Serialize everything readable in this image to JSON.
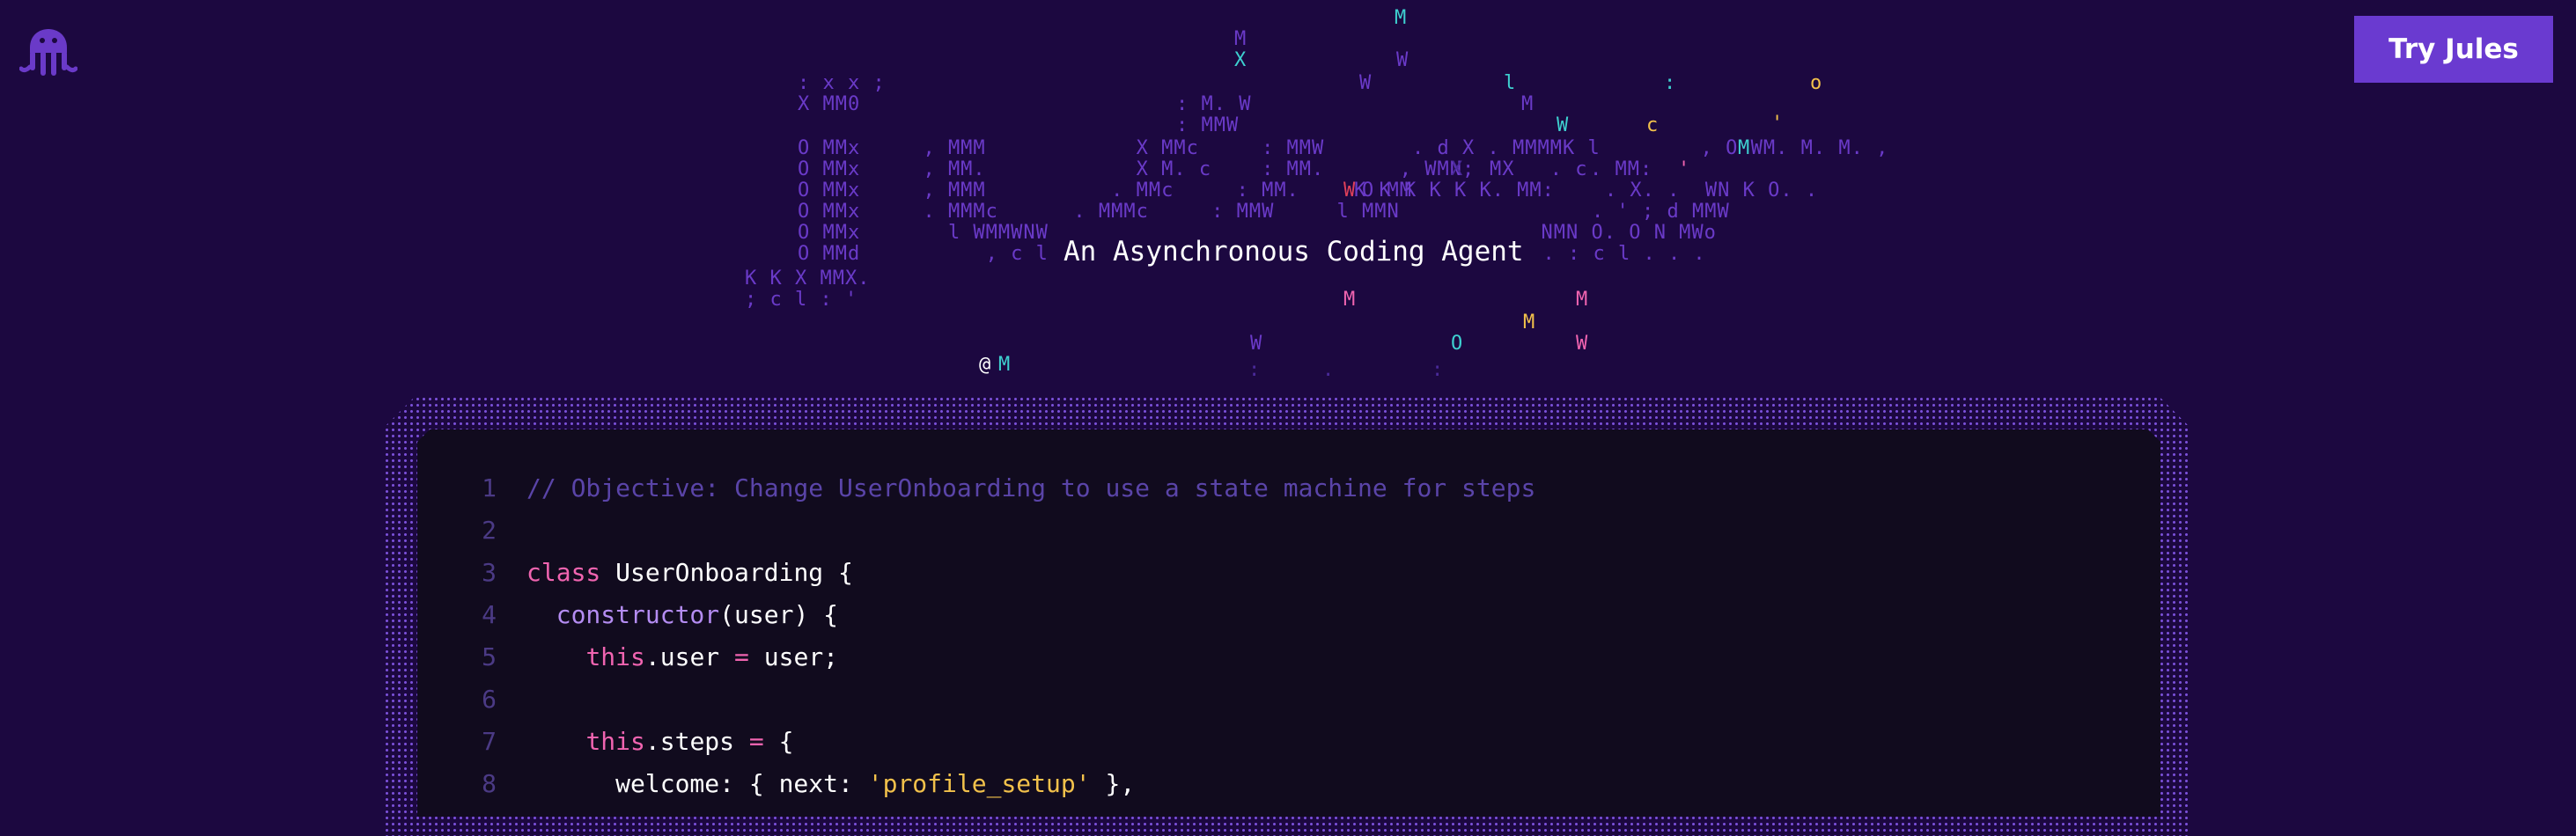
{
  "header": {
    "logo_icon": "octopus-logo-icon",
    "try_button_label": "Try Jules"
  },
  "hero": {
    "tagline": "An Asynchronous Coding Agent",
    "ascii_art": [
      {
        "text": "M",
        "color": "#3ed0d0",
        "left": 0,
        "top": 0
      },
      {
        "text": "M",
        "color": "#6a3ac8"
      },
      {
        "text": "X",
        "color": "#3ed0d0"
      },
      {
        "text": "W",
        "color": "#6a3ac8"
      },
      {
        "text": ": x x ;",
        "color": "#6a3ac8"
      },
      {
        "text": "W",
        "color": "#6a3ac8"
      },
      {
        "text": "l",
        "color": "#3ed0d0"
      },
      {
        "text": ":",
        "color": "#3ed0d0"
      },
      {
        "text": "o",
        "color": "#f2c14b"
      },
      {
        "text": "X MM0",
        "color": "#6a3ac8"
      },
      {
        "text": ": M. W",
        "color": "#6a3ac8"
      },
      {
        "text": "M",
        "color": "#6a3ac8"
      },
      {
        "text": ": MMW",
        "color": "#6a3ac8"
      },
      {
        "text": "W",
        "color": "#3ed0d0"
      },
      {
        "text": "c",
        "color": "#f2c14b"
      },
      {
        "text": "'",
        "color": "#f2c14b"
      },
      {
        "text": "O MMx     , MMM            X MMc     : MMW       . d X . MMMMK l        , O WM. M. M. ,",
        "color": "#6a3ac8"
      },
      {
        "text": "M",
        "color": "#3ed0d0"
      },
      {
        "text": "O MMx     , MM.            X M. c    : MM.      , WMN;      . c",
        "color": "#6a3ac8"
      },
      {
        "text": "X",
        "color": "#4a2a9a"
      },
      {
        "text": "MX      . MM:",
        "color": "#6a3ac8"
      },
      {
        "text": "'",
        "color": "#f064b0"
      },
      {
        "text": "O MMx     , MMM          . MMc     : MM.     O MM",
        "color": "#6a3ac8"
      },
      {
        "text": "W",
        "color": "#e0405a"
      },
      {
        "text": "K K K K K K. MM:    . X. .  WN K O. .",
        "color": "#6a3ac8"
      },
      {
        "text": "O MMx     . MMMc      . MMMc     : MMW     l MMN",
        "color": "#6a3ac8"
      },
      {
        "text": ". ' ; d MMW",
        "color": "#6a3ac8"
      },
      {
        "text": "O MMx       l WMMWNW",
        "color": "#6a3ac8"
      },
      {
        "text": ". NMN O. O N MWo",
        "color": "#6a3ac8"
      },
      {
        "text": "O MMd          , c l c ,",
        "color": "#6a3ac8"
      },
      {
        "text": ". . : c l . . .",
        "color": "#6a3ac8"
      },
      {
        "text": "K K X MMX.",
        "color": "#6a3ac8"
      },
      {
        "text": "; c l : '",
        "color": "#6a3ac8"
      },
      {
        "text": "M",
        "color": "#f064b0"
      },
      {
        "text": "M",
        "color": "#f064b0"
      },
      {
        "text": "M",
        "color": "#f2c14b"
      },
      {
        "text": "W",
        "color": "#6a3ac8"
      },
      {
        "text": "O",
        "color": "#3ed0d0"
      },
      {
        "text": "W",
        "color": "#f064b0"
      },
      {
        "text": "@",
        "color": "#ffffff"
      },
      {
        "text": "M",
        "color": "#3ed0d0"
      },
      {
        "text": ":",
        "color": "#4a2a9a"
      },
      {
        "text": ".",
        "color": "#4a2a9a"
      },
      {
        "text": ":",
        "color": "#4a2a9a"
      }
    ]
  },
  "editor": {
    "lines": [
      {
        "n": "1",
        "tokens": [
          {
            "t": "// Objective: Change UserOnboarding to use a state machine for steps",
            "k": "comment"
          }
        ]
      },
      {
        "n": "2",
        "tokens": []
      },
      {
        "n": "3",
        "tokens": [
          {
            "t": "class",
            "k": "kw"
          },
          {
            "t": " UserOnboarding {",
            "k": "plain"
          }
        ]
      },
      {
        "n": "4",
        "tokens": [
          {
            "t": "  ",
            "k": "plain"
          },
          {
            "t": "constructor",
            "k": "fn"
          },
          {
            "t": "(user) {",
            "k": "plain"
          }
        ]
      },
      {
        "n": "5",
        "tokens": [
          {
            "t": "    ",
            "k": "plain"
          },
          {
            "t": "this",
            "k": "kw"
          },
          {
            "t": ".user ",
            "k": "plain"
          },
          {
            "t": "=",
            "k": "kw"
          },
          {
            "t": " user;",
            "k": "plain"
          }
        ]
      },
      {
        "n": "6",
        "tokens": []
      },
      {
        "n": "7",
        "tokens": [
          {
            "t": "    ",
            "k": "plain"
          },
          {
            "t": "this",
            "k": "kw"
          },
          {
            "t": ".steps ",
            "k": "plain"
          },
          {
            "t": "=",
            "k": "kw"
          },
          {
            "t": " {",
            "k": "plain"
          }
        ]
      },
      {
        "n": "8",
        "tokens": [
          {
            "t": "      welcome: { next: ",
            "k": "plain"
          },
          {
            "t": "'profile_setup'",
            "k": "str"
          },
          {
            "t": " },",
            "k": "plain"
          }
        ]
      }
    ]
  }
}
